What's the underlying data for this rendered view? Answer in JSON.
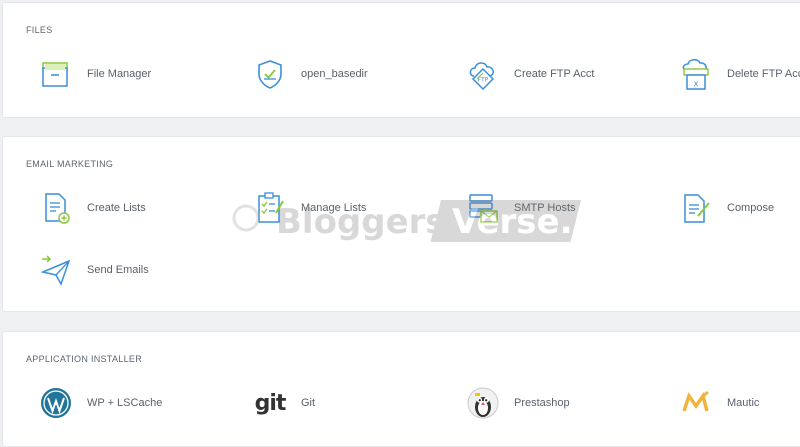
{
  "sections": {
    "files": {
      "title": "FILES",
      "items": [
        {
          "label": "File Manager",
          "icon": "folder-icon"
        },
        {
          "label": "open_basedir",
          "icon": "shield-icon"
        },
        {
          "label": "Create FTP Acct",
          "icon": "ftp-cloud-icon"
        },
        {
          "label": "Delete FTP Acct",
          "icon": "ftp-delete-icon"
        }
      ]
    },
    "email": {
      "title": "EMAIL MARKETING",
      "items": [
        {
          "label": "Create Lists",
          "icon": "document-add-icon"
        },
        {
          "label": "Manage Lists",
          "icon": "clipboard-checklist-icon"
        },
        {
          "label": "SMTP Hosts",
          "icon": "server-mail-icon"
        },
        {
          "label": "Compose",
          "icon": "compose-icon"
        },
        {
          "label": "Send Emails",
          "icon": "paper-plane-icon"
        }
      ]
    },
    "apps": {
      "title": "APPLICATION INSTALLER",
      "items": [
        {
          "label": "WP + LSCache",
          "icon": "wordpress-icon"
        },
        {
          "label": "Git",
          "icon": "git-icon"
        },
        {
          "label": "Prestashop",
          "icon": "prestashop-icon"
        },
        {
          "label": "Mautic",
          "icon": "mautic-icon"
        }
      ]
    }
  },
  "watermark": "BloggersVerse.",
  "git_logo_text": "git",
  "colors": {
    "accent_blue": "#3b8fd9",
    "accent_green": "#9bd34a",
    "mautic": "#f2b33d",
    "wordpress": "#21759b"
  }
}
